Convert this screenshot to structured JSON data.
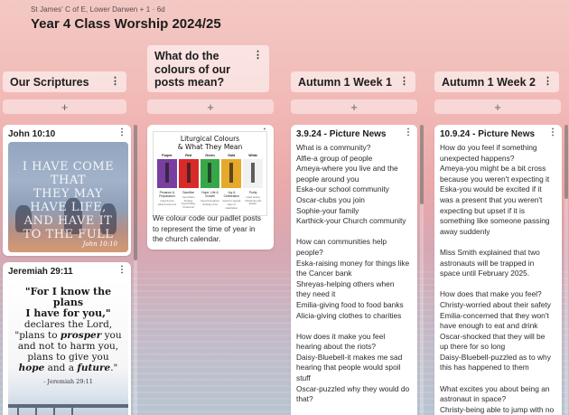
{
  "header": {
    "meta": "St James' C of E, Lower Darwen + 1 · 6d",
    "title": "Year 4 Class Worship 2024/25"
  },
  "columns": [
    {
      "title": "Our Scriptures",
      "add": "+",
      "cards": [
        {
          "title": "John 10:10",
          "image_text": "I HAVE COME THAT\nTHEY MAY\nHAVE LIFE,\nAND HAVE IT\nTO THE FULL",
          "image_ref": "John 10:10"
        },
        {
          "title": "Jeremiah 29:11",
          "quote_l1": "\"For I know the plans",
          "quote_l2": "I have for you,\"",
          "quote_l3": "declares the Lord,",
          "quote_l4a": "\"plans to ",
          "quote_l4b": "prosper",
          "quote_l4c": " you",
          "quote_l5": "and not to harm you,",
          "quote_l6": "plans to give you",
          "quote_l7a": "hope",
          "quote_l7b": " and a ",
          "quote_l7c": "future",
          "quote_l7d": ".\"",
          "quote_ref": "- Jeremiah 29:11"
        }
      ]
    },
    {
      "title": "What do the colours of our posts mean?",
      "add": "+",
      "cards": [
        {
          "image_title": "Liturgical Colours\n& What They Mean",
          "swatches": [
            {
              "label": "Purple",
              "color": "#7a3ea0",
              "caption": "Penance &\nPreparation",
              "sub": "Used during\nAdvent and Lent"
            },
            {
              "label": "Red",
              "color": "#d82a2a",
              "caption": "Sacrifice",
              "sub": "Used Palm Sunday,\nGood Friday,\nPentecost"
            },
            {
              "label": "Green",
              "color": "#37a84a",
              "caption": "Hope, Life &\nGrowth",
              "sub": "Used throughout\nOrdinary time"
            },
            {
              "label": "Gold",
              "color": "#e6a92b",
              "caption": "Joy &\nCelebration",
              "sub": "Used for special\ndays of celebration"
            },
            {
              "label": "White",
              "color": "#f1f1f1",
              "caption": "Purity",
              "sub": "Used during\nChristmas and\nEaster"
            }
          ],
          "body": "We colour code our padlet posts to represent the time of year in the church calendar."
        }
      ]
    },
    {
      "title": "Autumn 1 Week 1",
      "add": "+",
      "cards": [
        {
          "title": "3.9.24 - Picture News",
          "body": "What is a community?\nAlfie-a group of people\nAmeya-where you live and the people around you\nEska-our school community\nOscar-clubs you join\nSophie-your family\nKarthick-your Church community\n\nHow can communities help people?\nEska-raising money for things like the Cancer bank\nShreyas-helping others when they need it\nEmilia-giving food to food banks\nAlicia-giving clothes to charities\n\nHow does it make you feel hearing about the riots?\nDaisy-Bluebell-it makes me sad hearing that people would spoil stuff\nOscar-puzzled why they would do that?"
        }
      ]
    },
    {
      "title": "Autumn 1 Week 2",
      "add": "+",
      "cards": [
        {
          "title": "10.9.24 - Picture News",
          "body": "How do you feel if something unexpected happens?\nAmeya-you might be a bit cross because you weren't expecting it\nEska-you would be excited if it was a present that you weren't expecting but upset if it is something like someone passing away suddenly\n\nMiss Smith explained that two astronauts will be trapped in space until February 2025.\n\nHow does that make you feel?\nChristy-worried about their safety\nEmilia-concerned that they won't have enough to eat and drink\nOscar-shocked that they will be up there for so long\nDaisy-Bluebell-puzzled as to why this has happened to them\n\nWhat excites you about being an astronaut in space?\nChristy-being able to jump with no"
        }
      ]
    }
  ]
}
